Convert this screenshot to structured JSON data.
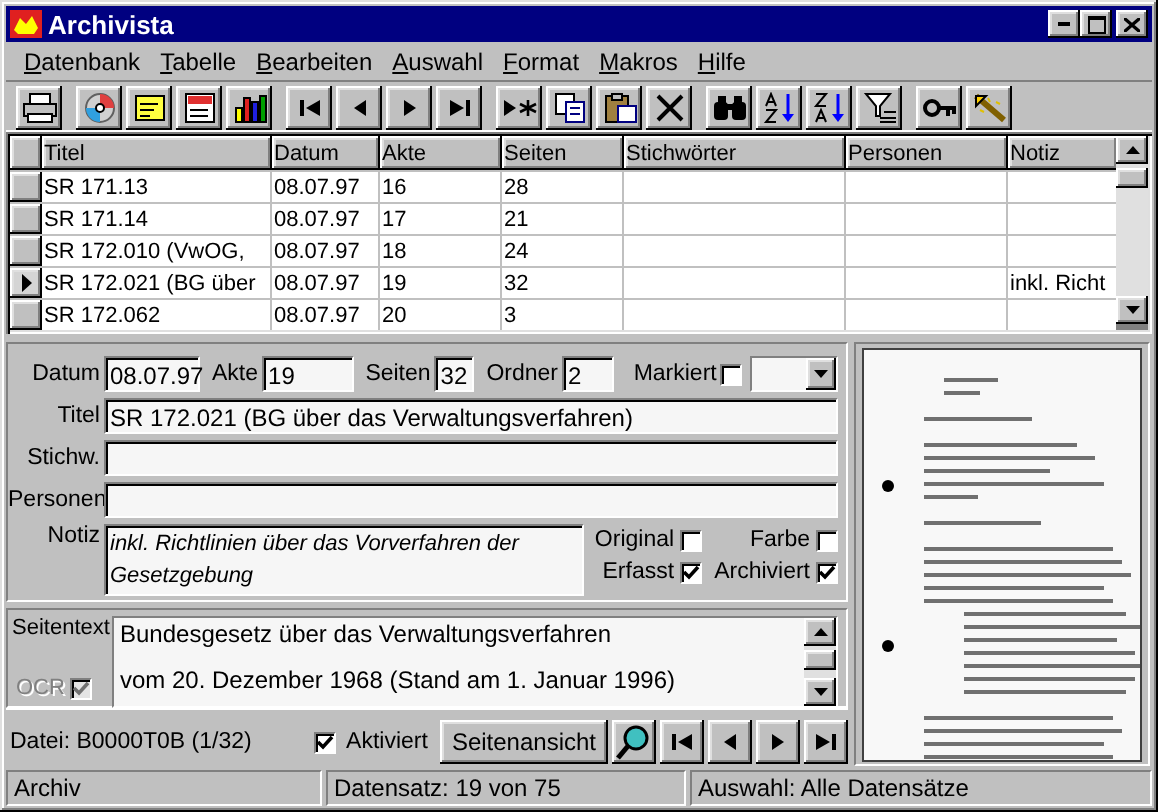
{
  "window": {
    "title": "Archivista"
  },
  "menu": [
    "Datenbank",
    "Tabelle",
    "Bearbeiten",
    "Auswahl",
    "Format",
    "Makros",
    "Hilfe"
  ],
  "table": {
    "columns": [
      "Titel",
      "Datum",
      "Akte",
      "Seiten",
      "Stichwörter",
      "Personen",
      "Notiz"
    ],
    "rows": [
      {
        "selected": false,
        "titel": "SR 171.13",
        "datum": "08.07.97",
        "akte": "16",
        "seiten": "28"
      },
      {
        "selected": false,
        "titel": "SR 171.14",
        "datum": "08.07.97",
        "akte": "17",
        "seiten": "21"
      },
      {
        "selected": false,
        "titel": "SR 172.010 (VwOG,",
        "datum": "08.07.97",
        "akte": "18",
        "seiten": "24"
      },
      {
        "selected": true,
        "titel": "SR 172.021 (BG über",
        "datum": "08.07.97",
        "akte": "19",
        "seiten": "32",
        "notiz": "inkl. Richt"
      },
      {
        "selected": false,
        "titel": "SR 172.062",
        "datum": "08.07.97",
        "akte": "20",
        "seiten": "3"
      }
    ]
  },
  "form": {
    "top_fields": [
      {
        "label": "Datum",
        "value": "08.07.97"
      },
      {
        "label": "Akte",
        "value": "19"
      },
      {
        "label": "Seiten",
        "value": "32"
      },
      {
        "label": "Ordner",
        "value": "2"
      }
    ],
    "markiert": {
      "label": "Markiert",
      "checked": false
    },
    "titel": {
      "label": "Titel",
      "value": "SR 172.021 (BG über das Verwaltungsverfahren)"
    },
    "stichw": {
      "label": "Stichw."
    },
    "personen": {
      "label": "Personen"
    },
    "notiz": {
      "label": "Notiz",
      "value": "inkl. Richtlinien über das Vorverfahren der Gesetzgebung"
    },
    "flags": [
      {
        "label": "Original",
        "checked": false
      },
      {
        "label": "Farbe",
        "checked": false
      },
      {
        "label": "Erfasst",
        "checked": true
      },
      {
        "label": "Archiviert",
        "checked": true
      }
    ],
    "seitentext": {
      "label": "Seitentext",
      "lines": [
        "Bundesgesetz über das Verwaltungsverfahren",
        "vom 20. Dezember 1968 (Stand am 1. Januar 1996)"
      ]
    },
    "ocr": {
      "label": "OCR",
      "checked": true,
      "disabled": true
    }
  },
  "footer": {
    "datei": "Datei: B0000T0B (1/32)",
    "aktiviert": {
      "label": "Aktiviert",
      "checked": true
    },
    "seitenansicht": "Seitenansicht"
  },
  "status_bar": [
    "Archiv",
    "Datensatz: 19 von 75",
    "Auswahl: Alle Datensätze"
  ]
}
